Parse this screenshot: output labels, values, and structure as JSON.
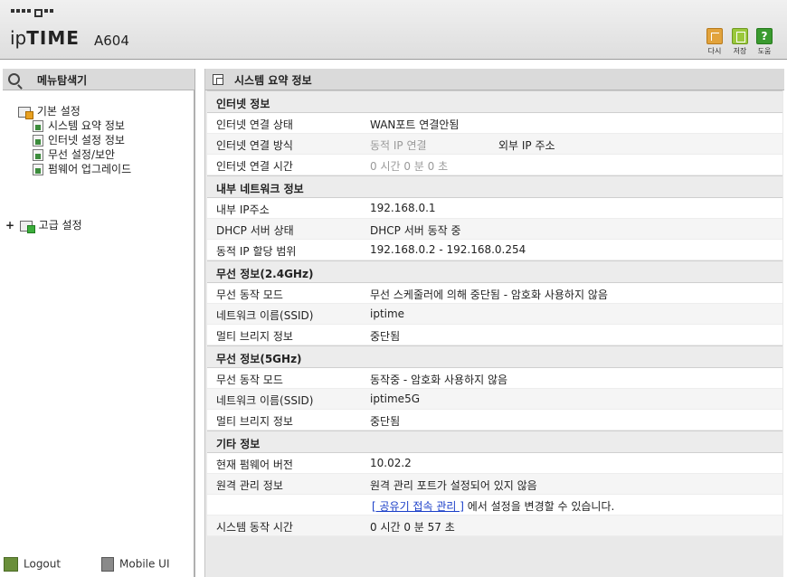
{
  "header": {
    "logo_prefix": "ip",
    "logo_bold": "TIME",
    "model": "A604",
    "buttons": [
      {
        "label": "다시",
        "icon": "refresh-icon"
      },
      {
        "label": "저장",
        "icon": "save-icon"
      },
      {
        "label": "도움",
        "icon": "help-icon",
        "glyph": "?"
      }
    ]
  },
  "sidebar": {
    "title": "메뉴탐색기",
    "basic": {
      "label": "기본 설정",
      "items": [
        {
          "label": "시스템 요약 정보"
        },
        {
          "label": "인터넷 설정 정보"
        },
        {
          "label": "무선 설정/보안"
        },
        {
          "label": "펌웨어 업그레이드"
        }
      ]
    },
    "advanced": {
      "expander": "+",
      "label": "고급 설정"
    },
    "footer": {
      "logout": "Logout",
      "mobile": "Mobile UI"
    }
  },
  "main": {
    "title": "시스템 요약 정보",
    "sections": [
      {
        "title": "인터넷 정보",
        "rows": [
          {
            "label": "인터넷 연결 상태",
            "value": "WAN포트 연결안됨"
          },
          {
            "label": "인터넷 연결 방식",
            "value": "동적 IP 연결",
            "value2": "외부 IP 주소"
          },
          {
            "label": "인터넷 연결 시간",
            "value": "0 시간 0 분 0 초"
          }
        ]
      },
      {
        "title": "내부 네트워크 정보",
        "rows": [
          {
            "label": "내부 IP주소",
            "value": "192.168.0.1"
          },
          {
            "label": "DHCP 서버 상태",
            "value": "DHCP 서버 동작 중"
          },
          {
            "label": "동적 IP 할당 범위",
            "value": "192.168.0.2 -  192.168.0.254"
          }
        ]
      },
      {
        "title": "무선 정보(2.4GHz)",
        "rows": [
          {
            "label": "무선 동작 모드",
            "value": "무선 스케줄러에 의해 중단됨 - 암호화 사용하지 않음"
          },
          {
            "label": "네트워크 이름(SSID)",
            "value": "iptime"
          },
          {
            "label": "멀티 브리지 정보",
            "value": "중단됨"
          }
        ]
      },
      {
        "title": "무선 정보(5GHz)",
        "rows": [
          {
            "label": "무선 동작 모드",
            "value": "동작중 - 암호화 사용하지 않음"
          },
          {
            "label": "네트워크 이름(SSID)",
            "value": "iptime5G"
          },
          {
            "label": "멀티 브리지 정보",
            "value": "중단됨"
          }
        ]
      },
      {
        "title": "기타 정보",
        "rows": [
          {
            "label": "현재 펌웨어 버전",
            "value": "10.02.2"
          },
          {
            "label": "원격 관리 정보",
            "value": "원격 관리 포트가 설정되어 있지 않음"
          },
          {
            "label": "",
            "link": "[ 공유기 접속 관리 ]",
            "value": " 에서 설정을 변경할 수 있습니다."
          },
          {
            "label": "시스템 동작 시간",
            "value": "0 시간 0 분 57 초"
          }
        ]
      }
    ]
  }
}
